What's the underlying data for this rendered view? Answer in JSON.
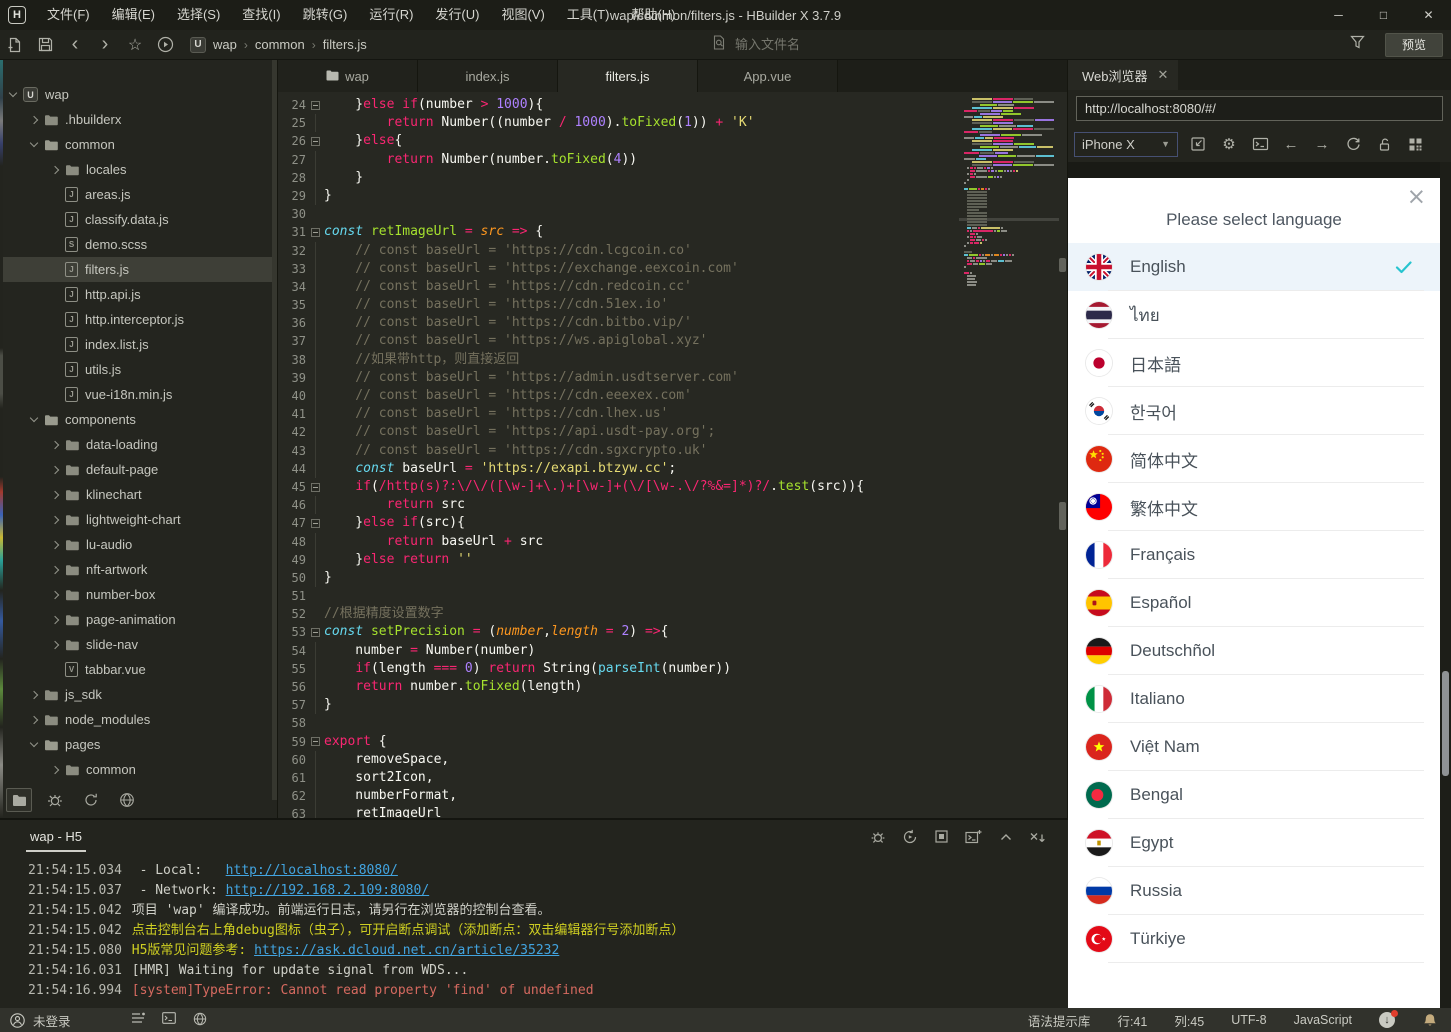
{
  "window": {
    "title": "wap/common/filters.js - HBuilder X 3.7.9",
    "menu": [
      "文件(F)",
      "编辑(E)",
      "选择(S)",
      "查找(I)",
      "跳转(G)",
      "运行(R)",
      "发行(U)",
      "视图(V)",
      "工具(T)",
      "帮助(H)"
    ]
  },
  "toolbar": {
    "breadcrumb": [
      "wap",
      "common",
      "filters.js"
    ],
    "search_placeholder": "输入文件名",
    "preview_label": "预览"
  },
  "tree": {
    "items": [
      {
        "label": "wap",
        "depth": 0,
        "type": "project",
        "state": "open"
      },
      {
        "label": ".hbuilderx",
        "depth": 1,
        "type": "folder",
        "state": "closed"
      },
      {
        "label": "common",
        "depth": 1,
        "type": "folder",
        "state": "open"
      },
      {
        "label": "locales",
        "depth": 2,
        "type": "folder",
        "state": "closed"
      },
      {
        "label": "areas.js",
        "depth": 2,
        "type": "js"
      },
      {
        "label": "classify.data.js",
        "depth": 2,
        "type": "js"
      },
      {
        "label": "demo.scss",
        "depth": 2,
        "type": "scss"
      },
      {
        "label": "filters.js",
        "depth": 2,
        "type": "js",
        "selected": true
      },
      {
        "label": "http.api.js",
        "depth": 2,
        "type": "js"
      },
      {
        "label": "http.interceptor.js",
        "depth": 2,
        "type": "js"
      },
      {
        "label": "index.list.js",
        "depth": 2,
        "type": "js"
      },
      {
        "label": "utils.js",
        "depth": 2,
        "type": "js"
      },
      {
        "label": "vue-i18n.min.js",
        "depth": 2,
        "type": "js"
      },
      {
        "label": "components",
        "depth": 1,
        "type": "folder",
        "state": "open"
      },
      {
        "label": "data-loading",
        "depth": 2,
        "type": "folder",
        "state": "closed"
      },
      {
        "label": "default-page",
        "depth": 2,
        "type": "folder",
        "state": "closed"
      },
      {
        "label": "klinechart",
        "depth": 2,
        "type": "folder",
        "state": "closed"
      },
      {
        "label": "lightweight-chart",
        "depth": 2,
        "type": "folder",
        "state": "closed"
      },
      {
        "label": "lu-audio",
        "depth": 2,
        "type": "folder",
        "state": "closed"
      },
      {
        "label": "nft-artwork",
        "depth": 2,
        "type": "folder",
        "state": "closed"
      },
      {
        "label": "number-box",
        "depth": 2,
        "type": "folder",
        "state": "closed"
      },
      {
        "label": "page-animation",
        "depth": 2,
        "type": "folder",
        "state": "closed"
      },
      {
        "label": "slide-nav",
        "depth": 2,
        "type": "folder",
        "state": "closed"
      },
      {
        "label": "tabbar.vue",
        "depth": 2,
        "type": "vue"
      },
      {
        "label": "js_sdk",
        "depth": 1,
        "type": "folder",
        "state": "closed"
      },
      {
        "label": "node_modules",
        "depth": 1,
        "type": "folder",
        "state": "closed"
      },
      {
        "label": "pages",
        "depth": 1,
        "type": "folder",
        "state": "open"
      },
      {
        "label": "common",
        "depth": 2,
        "type": "folder",
        "state": "closed"
      }
    ]
  },
  "editor": {
    "tabs": [
      {
        "label": "wap",
        "icon": "folder",
        "active": false
      },
      {
        "label": "index.js",
        "active": false
      },
      {
        "label": "filters.js",
        "active": true
      },
      {
        "label": "App.vue",
        "active": false
      }
    ],
    "cursor_line": 41,
    "lines": [
      {
        "n": 24,
        "fold": true,
        "t": [
          [
            "w",
            "    }"
          ],
          [
            "k",
            "else"
          ],
          [
            "w",
            " "
          ],
          [
            "k",
            "if"
          ],
          [
            "w",
            "(number "
          ],
          [
            "k",
            ">"
          ],
          [
            "w",
            " "
          ],
          [
            "n",
            "1000"
          ],
          [
            "w",
            "){"
          ]
        ]
      },
      {
        "n": 25,
        "g": true,
        "t": [
          [
            "w",
            "        "
          ],
          [
            "k",
            "return"
          ],
          [
            "w",
            " Number((number "
          ],
          [
            "k",
            "/"
          ],
          [
            "w",
            " "
          ],
          [
            "n",
            "1000"
          ],
          [
            "w",
            ")."
          ],
          [
            "g",
            "toFixed"
          ],
          [
            "w",
            "("
          ],
          [
            "n",
            "1"
          ],
          [
            "w",
            ")) "
          ],
          [
            "k",
            "+"
          ],
          [
            "w",
            " "
          ],
          [
            "s",
            "'K'"
          ]
        ]
      },
      {
        "n": 26,
        "fold": true,
        "t": [
          [
            "w",
            "    }"
          ],
          [
            "k",
            "else"
          ],
          [
            "w",
            "{"
          ]
        ]
      },
      {
        "n": 27,
        "g": true,
        "t": [
          [
            "w",
            "        "
          ],
          [
            "k",
            "return"
          ],
          [
            "w",
            " Number(number."
          ],
          [
            "g",
            "toFixed"
          ],
          [
            "w",
            "("
          ],
          [
            "n",
            "4"
          ],
          [
            "w",
            "))"
          ]
        ]
      },
      {
        "n": 28,
        "g": true,
        "t": [
          [
            "w",
            "    }"
          ]
        ]
      },
      {
        "n": 29,
        "g": true,
        "t": [
          [
            "w",
            "}"
          ]
        ]
      },
      {
        "n": 30,
        "t": []
      },
      {
        "n": 31,
        "fold": true,
        "t": [
          [
            "cy",
            "const"
          ],
          [
            "w",
            " "
          ],
          [
            "g",
            "retImageUrl"
          ],
          [
            "w",
            " "
          ],
          [
            "k",
            "="
          ],
          [
            "w",
            " "
          ],
          [
            "o",
            "src"
          ],
          [
            "w",
            " "
          ],
          [
            "k",
            "=>"
          ],
          [
            "w",
            " {"
          ]
        ]
      },
      {
        "n": 32,
        "g": true,
        "t": [
          [
            "c",
            "    // const baseUrl = 'https://cdn.lcgcoin.co'"
          ]
        ]
      },
      {
        "n": 33,
        "g": true,
        "t": [
          [
            "c",
            "    // const baseUrl = 'https://exchange.eexcoin.com'"
          ]
        ]
      },
      {
        "n": 34,
        "g": true,
        "t": [
          [
            "c",
            "    // const baseUrl = 'https://cdn.redcoin.cc'"
          ]
        ]
      },
      {
        "n": 35,
        "g": true,
        "t": [
          [
            "c",
            "    // const baseUrl = 'https://cdn.51ex.io'"
          ]
        ]
      },
      {
        "n": 36,
        "g": true,
        "t": [
          [
            "c",
            "    // const baseUrl = 'https://cdn.bitbo.vip/'"
          ]
        ]
      },
      {
        "n": 37,
        "g": true,
        "t": [
          [
            "c",
            "    // const baseUrl = 'https://ws.apiglobal.xyz'"
          ]
        ]
      },
      {
        "n": 38,
        "g": true,
        "t": [
          [
            "c",
            "    //如果带http，则直接返回"
          ]
        ]
      },
      {
        "n": 39,
        "g": true,
        "t": [
          [
            "c",
            "    // const baseUrl = 'https://admin.usdtserver.com'"
          ]
        ]
      },
      {
        "n": 40,
        "g": true,
        "t": [
          [
            "c",
            "    // const baseUrl = 'https://cdn.eeexex.com'"
          ]
        ]
      },
      {
        "n": 41,
        "g": true,
        "t": [
          [
            "c",
            "    // const baseUrl = 'https://cdn.lhex.us'"
          ]
        ]
      },
      {
        "n": 42,
        "g": true,
        "t": [
          [
            "c",
            "    // const baseUrl = 'https://api.usdt-pay.org';"
          ]
        ]
      },
      {
        "n": 43,
        "g": true,
        "t": [
          [
            "c",
            "    // const baseUrl = 'https://cdn.sgxcrypto.uk'"
          ]
        ]
      },
      {
        "n": 44,
        "g": true,
        "t": [
          [
            "w",
            "    "
          ],
          [
            "cy",
            "const"
          ],
          [
            "w",
            " baseUrl "
          ],
          [
            "k",
            "="
          ],
          [
            "w",
            " "
          ],
          [
            "s",
            "'https://exapi.btzyw.cc'"
          ],
          [
            "w",
            ";"
          ]
        ]
      },
      {
        "n": 45,
        "fold": true,
        "t": [
          [
            "w",
            "    "
          ],
          [
            "k",
            "if"
          ],
          [
            "w",
            "("
          ],
          [
            "k",
            "/http(s)?:\\/\\/([\\w-]+\\.)+[\\w-]+(\\/[\\w-.\\/?%&=]*)?/"
          ],
          [
            "w",
            "."
          ],
          [
            "g",
            "test"
          ],
          [
            "w",
            "(src)){"
          ]
        ]
      },
      {
        "n": 46,
        "g": true,
        "t": [
          [
            "w",
            "        "
          ],
          [
            "k",
            "return"
          ],
          [
            "w",
            " src"
          ]
        ]
      },
      {
        "n": 47,
        "fold": true,
        "t": [
          [
            "w",
            "    }"
          ],
          [
            "k",
            "else"
          ],
          [
            "w",
            " "
          ],
          [
            "k",
            "if"
          ],
          [
            "w",
            "(src){"
          ]
        ]
      },
      {
        "n": 48,
        "g": true,
        "t": [
          [
            "w",
            "        "
          ],
          [
            "k",
            "return"
          ],
          [
            "w",
            " baseUrl "
          ],
          [
            "k",
            "+"
          ],
          [
            "w",
            " src"
          ]
        ]
      },
      {
        "n": 49,
        "g": true,
        "t": [
          [
            "w",
            "    }"
          ],
          [
            "k",
            "else"
          ],
          [
            "w",
            " "
          ],
          [
            "k",
            "return"
          ],
          [
            "w",
            " "
          ],
          [
            "s",
            "''"
          ]
        ]
      },
      {
        "n": 50,
        "g": true,
        "t": [
          [
            "w",
            "}"
          ]
        ]
      },
      {
        "n": 51,
        "t": []
      },
      {
        "n": 52,
        "t": [
          [
            "c",
            "//根据精度设置数字"
          ]
        ]
      },
      {
        "n": 53,
        "fold": true,
        "t": [
          [
            "cy",
            "const"
          ],
          [
            "w",
            " "
          ],
          [
            "g",
            "setPrecision"
          ],
          [
            "w",
            " "
          ],
          [
            "k",
            "="
          ],
          [
            "w",
            " ("
          ],
          [
            "o",
            "number"
          ],
          [
            "w",
            ","
          ],
          [
            "o",
            "length"
          ],
          [
            "w",
            " "
          ],
          [
            "k",
            "="
          ],
          [
            "w",
            " "
          ],
          [
            "n",
            "2"
          ],
          [
            "w",
            ") "
          ],
          [
            "k",
            "=>"
          ],
          [
            "w",
            "{"
          ]
        ]
      },
      {
        "n": 54,
        "g": true,
        "t": [
          [
            "w",
            "    number "
          ],
          [
            "k",
            "="
          ],
          [
            "w",
            " Number(number)"
          ]
        ]
      },
      {
        "n": 55,
        "g": true,
        "t": [
          [
            "w",
            "    "
          ],
          [
            "k",
            "if"
          ],
          [
            "w",
            "(length "
          ],
          [
            "k",
            "==="
          ],
          [
            "w",
            " "
          ],
          [
            "n",
            "0"
          ],
          [
            "w",
            ") "
          ],
          [
            "k",
            "return"
          ],
          [
            "w",
            " String("
          ],
          [
            "cyn",
            "parseInt"
          ],
          [
            "w",
            "(number))"
          ]
        ]
      },
      {
        "n": 56,
        "g": true,
        "t": [
          [
            "w",
            "    "
          ],
          [
            "k",
            "return"
          ],
          [
            "w",
            " number."
          ],
          [
            "g",
            "toFixed"
          ],
          [
            "w",
            "(length)"
          ]
        ]
      },
      {
        "n": 57,
        "g": true,
        "t": [
          [
            "w",
            "}"
          ]
        ]
      },
      {
        "n": 58,
        "t": []
      },
      {
        "n": 59,
        "fold": true,
        "t": [
          [
            "k",
            "export"
          ],
          [
            "w",
            " {"
          ]
        ]
      },
      {
        "n": 60,
        "g": true,
        "t": [
          [
            "w",
            "    removeSpace,"
          ]
        ]
      },
      {
        "n": 61,
        "g": true,
        "t": [
          [
            "w",
            "    sort2Icon,"
          ]
        ]
      },
      {
        "n": 62,
        "g": true,
        "t": [
          [
            "w",
            "    numberFormat,"
          ]
        ]
      },
      {
        "n": 63,
        "g": true,
        "t": [
          [
            "w",
            "    retImageUrl"
          ]
        ]
      }
    ]
  },
  "browser": {
    "tab_label": "Web浏览器",
    "url": "http://localhost:8080/#/",
    "device": "iPhone X",
    "modal": {
      "title": "Please select language",
      "languages": [
        {
          "label": "English",
          "flag": "gb",
          "selected": true
        },
        {
          "label": "ไทย",
          "flag": "th"
        },
        {
          "label": "日本語",
          "flag": "jp"
        },
        {
          "label": "한국어",
          "flag": "kr"
        },
        {
          "label": "简体中文",
          "flag": "cn"
        },
        {
          "label": "繁体中文",
          "flag": "tw"
        },
        {
          "label": "Français",
          "flag": "fr"
        },
        {
          "label": "Español",
          "flag": "es"
        },
        {
          "label": "Deutschñol",
          "flag": "de"
        },
        {
          "label": "Italiano",
          "flag": "it"
        },
        {
          "label": "Việt Nam",
          "flag": "vn"
        },
        {
          "label": "Bengal",
          "flag": "bd"
        },
        {
          "label": "Egypt",
          "flag": "eg"
        },
        {
          "label": "Russia",
          "flag": "ru"
        },
        {
          "label": "Türkiye",
          "flag": "tr"
        }
      ]
    }
  },
  "console": {
    "tab_label": "wap - H5",
    "lines": [
      {
        "time": "21:54:15.034",
        "parts": [
          {
            "s": "plain",
            "t": "  - Local:   "
          },
          {
            "s": "link",
            "t": "http://localhost:8080/"
          }
        ]
      },
      {
        "time": "21:54:15.037",
        "parts": [
          {
            "s": "plain",
            "t": "  - Network: "
          },
          {
            "s": "link",
            "t": "http://192.168.2.109:8080/"
          }
        ]
      },
      {
        "time": "21:54:15.042",
        "parts": [
          {
            "s": "plain",
            "t": " 项目 'wap' 编译成功。前端运行日志，请另行在浏览器的控制台查看。"
          }
        ]
      },
      {
        "time": "21:54:15.042",
        "parts": [
          {
            "s": "warn",
            "t": " 点击控制台右上角debug图标（虫子），可开启断点调试（添加断点：双击编辑器行号添加断点）"
          }
        ]
      },
      {
        "time": "21:54:15.080",
        "parts": [
          {
            "s": "warn",
            "t": " H5版常见问题参考: "
          },
          {
            "s": "link",
            "t": "https://ask.dcloud.net.cn/article/35232"
          }
        ]
      },
      {
        "time": "21:54:16.031",
        "parts": [
          {
            "s": "plain",
            "t": " [HMR] Waiting for update signal from WDS..."
          }
        ]
      },
      {
        "time": "21:54:16.994",
        "parts": [
          {
            "s": "error",
            "t": " [system]TypeError: Cannot read property 'find' of undefined"
          }
        ]
      }
    ]
  },
  "statusbar": {
    "login": "未登录",
    "items": [
      "语法提示库",
      "行:41",
      "列:45",
      "UTF-8",
      "JavaScript"
    ]
  },
  "colors": {
    "accent": "#f92672",
    "check": "#27c4cf",
    "link": "#42a4e0",
    "warn": "#cfcf22",
    "error": "#d66a60",
    "selected_row": "#edf4fa"
  }
}
